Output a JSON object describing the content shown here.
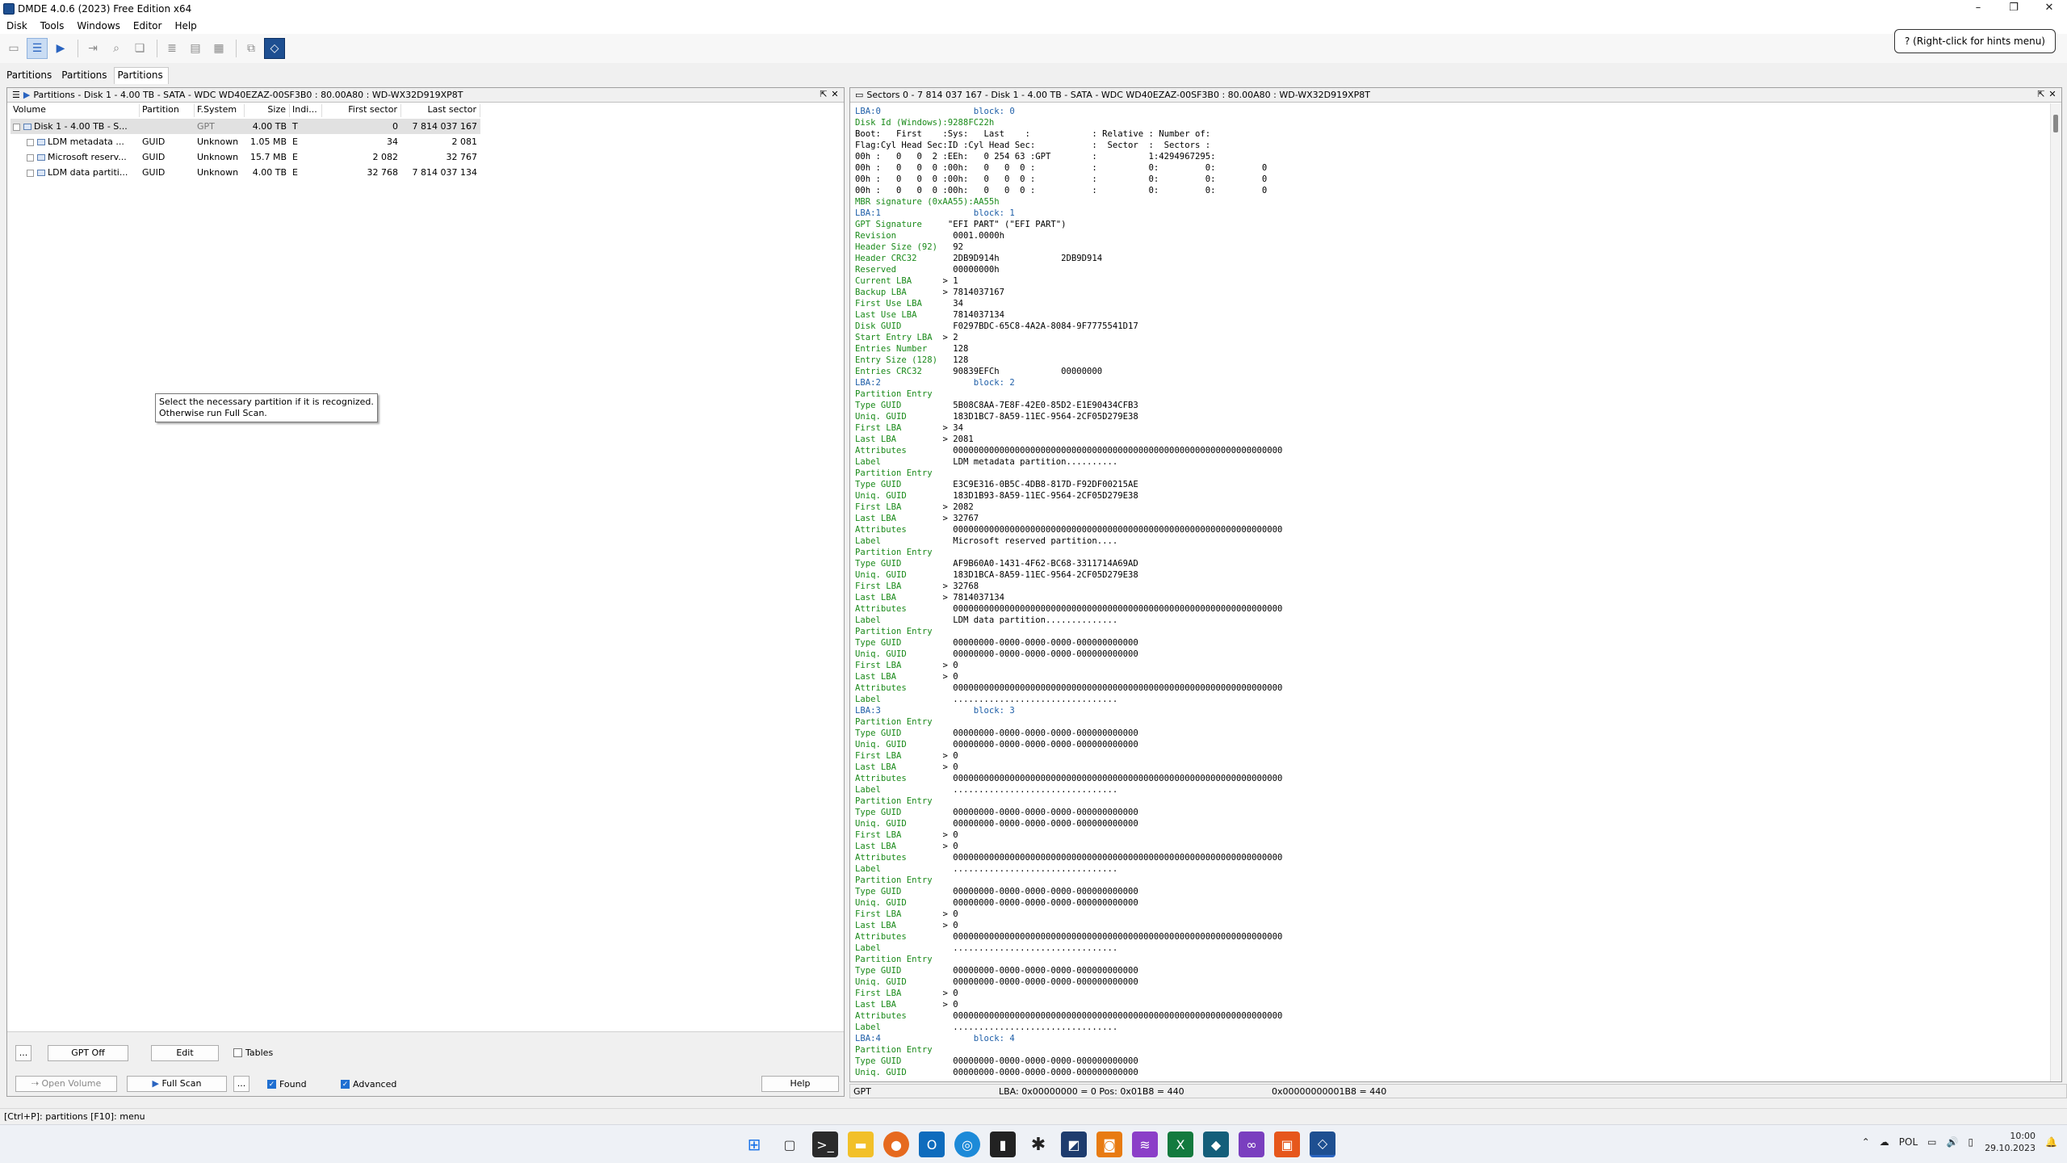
{
  "window": {
    "title": "DMDE 4.0.6 (2023) Free Edition x64",
    "minimize": "–",
    "restore": "❐",
    "close": "✕"
  },
  "menu": [
    "Disk",
    "Tools",
    "Windows",
    "Editor",
    "Help"
  ],
  "hint": "? (Right-click for hints menu)",
  "tabs": [
    "Partitions",
    "Partitions",
    "Partitions"
  ],
  "left_panel": {
    "title": "Partitions - Disk 1 - 4.00 TB - SATA - WDC WD40EZAZ-00SF3B0 : 80.00A80 : WD-WX32D919XP8T",
    "columns": [
      "Volume",
      "Partition",
      "F.System",
      "Size",
      "Indi...",
      "First sector",
      "Last sector"
    ],
    "rows": [
      {
        "volume": "Disk 1 - 4.00 TB - S...",
        "partition": "",
        "fs": "GPT",
        "size": "4.00 TB",
        "ind": "T",
        "first": "0",
        "last": "7 814 037 167"
      },
      {
        "volume": "LDM metadata ...",
        "partition": "GUID",
        "fs": "Unknown",
        "size": "1.05 MB",
        "ind": "E",
        "first": "34",
        "last": "2 081"
      },
      {
        "volume": "Microsoft reserv...",
        "partition": "GUID",
        "fs": "Unknown",
        "size": "15.7 MB",
        "ind": "E",
        "first": "2 082",
        "last": "32 767"
      },
      {
        "volume": "LDM data partiti...",
        "partition": "GUID",
        "fs": "Unknown",
        "size": "4.00 TB",
        "ind": "E",
        "first": "32 768",
        "last": "7 814 037 134"
      }
    ],
    "tooltip_line1": "Select the necessary partition if it is recognized.",
    "tooltip_line2": "Otherwise run Full Scan.",
    "buttons": {
      "more": "...",
      "gpt_off": "GPT Off",
      "edit": "Edit",
      "tables": "Tables",
      "open_volume": "Open Volume",
      "full_scan": "Full Scan",
      "more2": "...",
      "found": "Found",
      "advanced": "Advanced",
      "help": "Help"
    }
  },
  "right_panel": {
    "title": "Sectors 0 - 7 814 037 167 - Disk 1 - 4.00 TB - SATA - WDC WD40EZAZ-00SF3B0 : 80.00A80 : WD-WX32D919XP8T",
    "status": {
      "left": "GPT",
      "mid": "LBA: 0x00000000 = 0  Pos: 0x01B8 = 440",
      "right": "0x00000000001B8 = 440"
    },
    "lines": [
      "LBA:0                  block: 0",
      "Disk Id (Windows):9288FC22h",
      "Boot:   First    :Sys:   Last    :            : Relative : Number of:",
      "Flag:Cyl Head Sec:ID :Cyl Head Sec:           :  Sector  :  Sectors :",
      "00h :   0   0  2 :EEh:   0 254 63 :GPT        :          1:4294967295:",
      "00h :   0   0  0 :00h:   0   0  0 :           :          0:         0:         0",
      "00h :   0   0  0 :00h:   0   0  0 :           :          0:         0:         0",
      "00h :   0   0  0 :00h:   0   0  0 :           :          0:         0:         0",
      "MBR signature (0xAA55):AA55h",
      "LBA:1                  block: 1",
      "GPT Signature     \"EFI PART\" (\"EFI PART\")",
      "Revision           0001.0000h",
      "Header Size (92)   92",
      "Header CRC32       2DB9D914h            2DB9D914",
      "Reserved           00000000h",
      "Current LBA      > 1",
      "Backup LBA       > 7814037167",
      "First Use LBA      34",
      "Last Use LBA       7814037134",
      "Disk GUID          F0297BDC-65C8-4A2A-8084-9F7775541D17",
      "Start Entry LBA  > 2",
      "Entries Number     128",
      "Entry Size (128)   128",
      "Entries CRC32      90839EFCh            00000000",
      "LBA:2                  block: 2",
      "Partition Entry",
      "Type GUID          5B08C8AA-7E8F-42E0-85D2-E1E90434CFB3",
      "Uniq. GUID         183D1BC7-8A59-11EC-9564-2CF05D279E38",
      "First LBA        > 34",
      "Last LBA         > 2081",
      "Attributes         0000000000000000000000000000000000000000000000000000000000000000",
      "Label              LDM metadata partition..........",
      "Partition Entry",
      "Type GUID          E3C9E316-0B5C-4DB8-817D-F92DF00215AE",
      "Uniq. GUID         183D1B93-8A59-11EC-9564-2CF05D279E38",
      "First LBA        > 2082",
      "Last LBA         > 32767",
      "Attributes         0000000000000000000000000000000000000000000000000000000000000000",
      "Label              Microsoft reserved partition....",
      "Partition Entry",
      "Type GUID          AF9B60A0-1431-4F62-BC68-3311714A69AD",
      "Uniq. GUID         183D1BCA-8A59-11EC-9564-2CF05D279E38",
      "First LBA        > 32768",
      "Last LBA         > 7814037134",
      "Attributes         0000000000000000000000000000000000000000000000000000000000000000",
      "Label              LDM data partition..............",
      "Partition Entry",
      "Type GUID          00000000-0000-0000-0000-000000000000",
      "Uniq. GUID         00000000-0000-0000-0000-000000000000",
      "First LBA        > 0",
      "Last LBA         > 0",
      "Attributes         0000000000000000000000000000000000000000000000000000000000000000",
      "Label              ................................",
      "LBA:3                  block: 3",
      "Partition Entry",
      "Type GUID          00000000-0000-0000-0000-000000000000",
      "Uniq. GUID         00000000-0000-0000-0000-000000000000",
      "First LBA        > 0",
      "Last LBA         > 0",
      "Attributes         0000000000000000000000000000000000000000000000000000000000000000",
      "Label              ................................",
      "Partition Entry",
      "Type GUID          00000000-0000-0000-0000-000000000000",
      "Uniq. GUID         00000000-0000-0000-0000-000000000000",
      "First LBA        > 0",
      "Last LBA         > 0",
      "Attributes         0000000000000000000000000000000000000000000000000000000000000000",
      "Label              ................................",
      "Partition Entry",
      "Type GUID          00000000-0000-0000-0000-000000000000",
      "Uniq. GUID         00000000-0000-0000-0000-000000000000",
      "First LBA        > 0",
      "Last LBA         > 0",
      "Attributes         0000000000000000000000000000000000000000000000000000000000000000",
      "Label              ................................",
      "Partition Entry",
      "Type GUID          00000000-0000-0000-0000-000000000000",
      "Uniq. GUID         00000000-0000-0000-0000-000000000000",
      "First LBA        > 0",
      "Last LBA         > 0",
      "Attributes         0000000000000000000000000000000000000000000000000000000000000000",
      "Label              ................................",
      "LBA:4                  block: 4",
      "Partition Entry",
      "Type GUID          00000000-0000-0000-0000-000000000000",
      "Uniq. GUID         00000000-0000-0000-0000-000000000000"
    ]
  },
  "status_bar": "[Ctrl+P]: partitions  [F10]: menu",
  "tray": {
    "lang": "POL",
    "time": "10:00",
    "date": "29.10.2023"
  },
  "colors": {
    "accent": "#2a64c0",
    "label_green": "#1a8a1a",
    "lba_blue": "#1f5fa8"
  }
}
